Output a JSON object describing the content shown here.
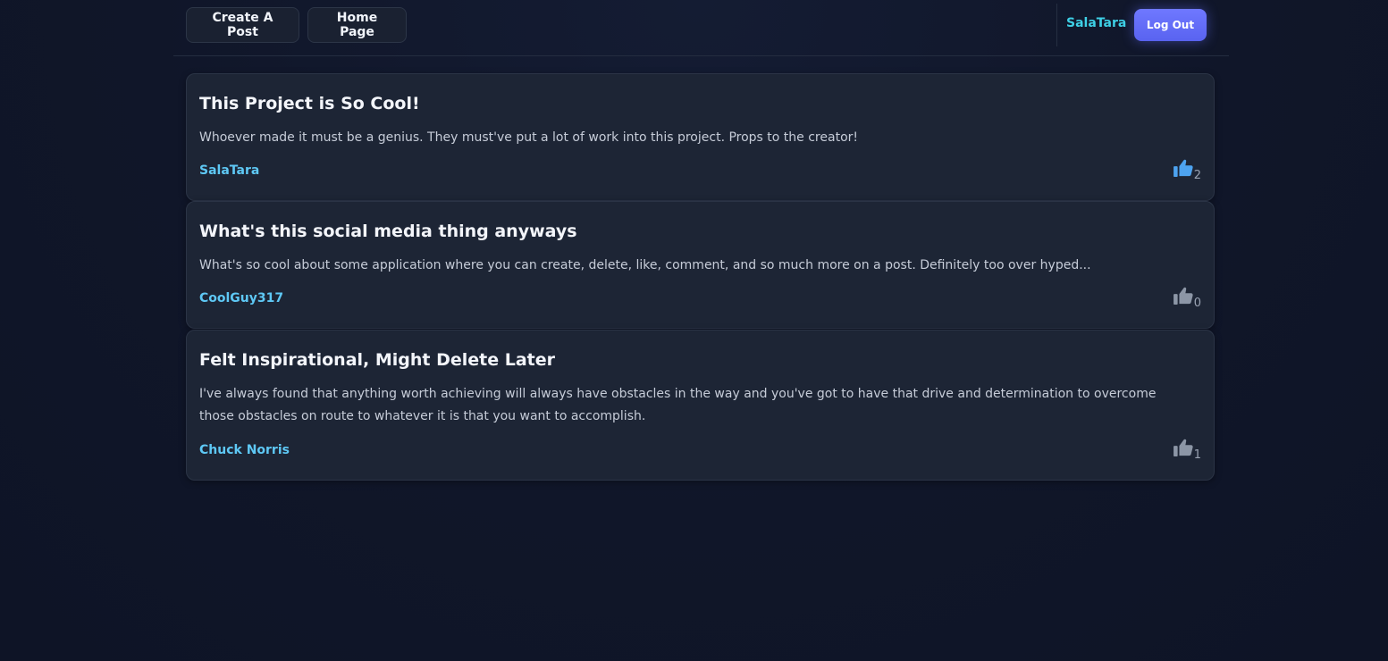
{
  "nav": {
    "create_label": "Create A Post",
    "home_label": "Home Page",
    "username": "SalaTara",
    "logout_label": "Log Out"
  },
  "colors": {
    "accent": "#5963f0",
    "username": "#3ed0e6",
    "author": "#5ec8f5",
    "liked": "#4da3f0",
    "not_liked": "#8c96a6"
  },
  "posts": [
    {
      "title": "This Project is So Cool!",
      "body": "Whoever made it must be a genius. They must've put a lot of work into this project. Props to the creator!",
      "author": "SalaTara",
      "likes": "2",
      "liked": true,
      "like_icon": "thumbs-up-icon"
    },
    {
      "title": "What's this social media thing anyways",
      "body": "What's so cool about some application where you can create, delete, like, comment, and so much more on a post. Definitely too over hyped...",
      "author": "CoolGuy317",
      "likes": "0",
      "liked": false,
      "like_icon": "thumbs-up-icon"
    },
    {
      "title": "Felt Inspirational, Might Delete Later",
      "body": "I've always found that anything worth achieving will always have obstacles in the way and you've got to have that drive and determination to overcome those obstacles on route to whatever it is that you want to accomplish.",
      "author": "Chuck Norris",
      "likes": "1",
      "liked": false,
      "like_icon": "thumbs-up-icon"
    }
  ]
}
